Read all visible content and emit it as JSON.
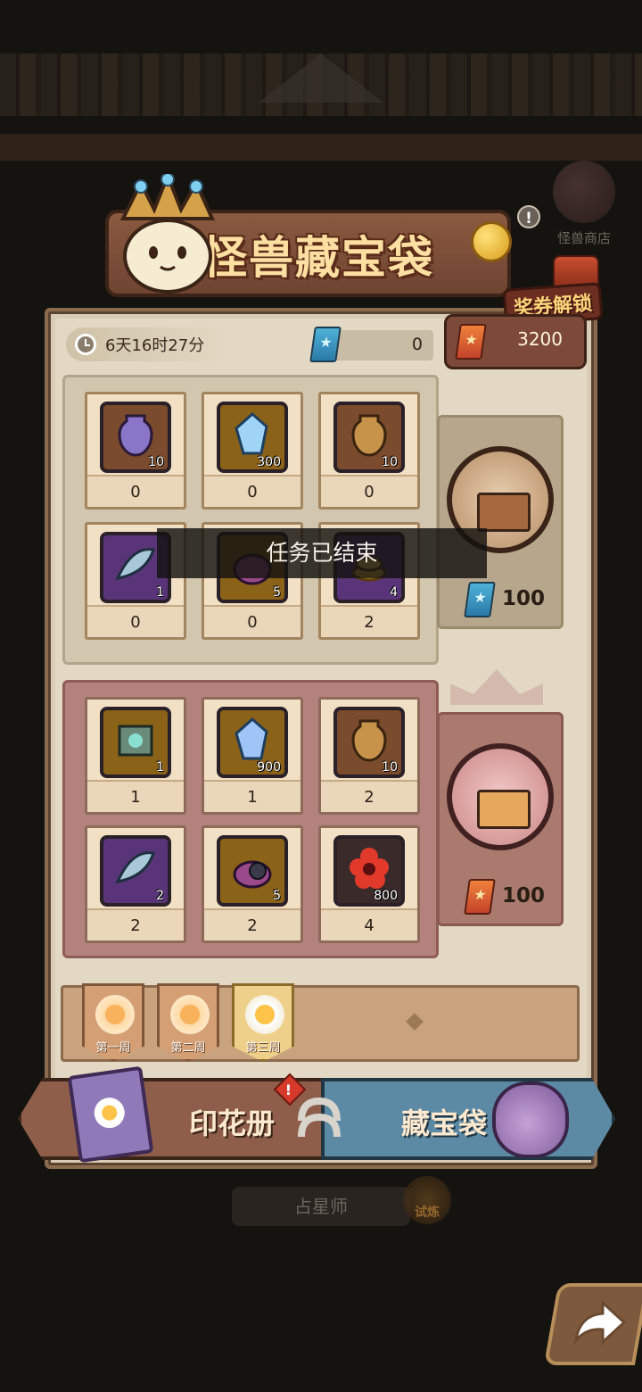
{
  "background": {
    "shop_label": "怪兽商店",
    "astrologer_label": "占星师",
    "trial_label": "试炼"
  },
  "header": {
    "title": "怪兽藏宝袋",
    "unlock_label": "奖券解锁",
    "info_icon": "info-icon"
  },
  "status": {
    "timer": "6天16时27分",
    "blue_tickets": "0",
    "red_tickets": "3200"
  },
  "normal_pool": {
    "items": [
      {
        "name": "purple-vase",
        "qty": "10",
        "count": "0"
      },
      {
        "name": "blue-crystal",
        "qty": "300",
        "count": "0"
      },
      {
        "name": "bronze-vase",
        "qty": "10",
        "count": "0"
      },
      {
        "name": "feather-fish",
        "qty": "1",
        "count": "0"
      },
      {
        "name": "monster-bag",
        "qty": "5",
        "count": "0"
      },
      {
        "name": "gold-coins",
        "qty": "4",
        "count": "2"
      }
    ],
    "cost": "100"
  },
  "premium_pool": {
    "items": [
      {
        "name": "magic-book",
        "qty": "1",
        "count": "1"
      },
      {
        "name": "blue-crystal",
        "qty": "900",
        "count": "1"
      },
      {
        "name": "bronze-vase",
        "qty": "10",
        "count": "2"
      },
      {
        "name": "feather-fish",
        "qty": "2",
        "count": "2"
      },
      {
        "name": "cat-bag",
        "qty": "5",
        "count": "2"
      },
      {
        "name": "red-flower",
        "qty": "800",
        "count": "4"
      }
    ],
    "cost": "100"
  },
  "weeks": [
    "第一周",
    "第二周",
    "第三周"
  ],
  "tabs": {
    "stamp_book": "印花册",
    "treasure_bag": "藏宝袋",
    "alert": "!"
  },
  "toast": "任务已结束",
  "colors": {
    "panel": "#e3d8c3",
    "premium": "#b4827c",
    "accent": "#ffe0a2"
  }
}
